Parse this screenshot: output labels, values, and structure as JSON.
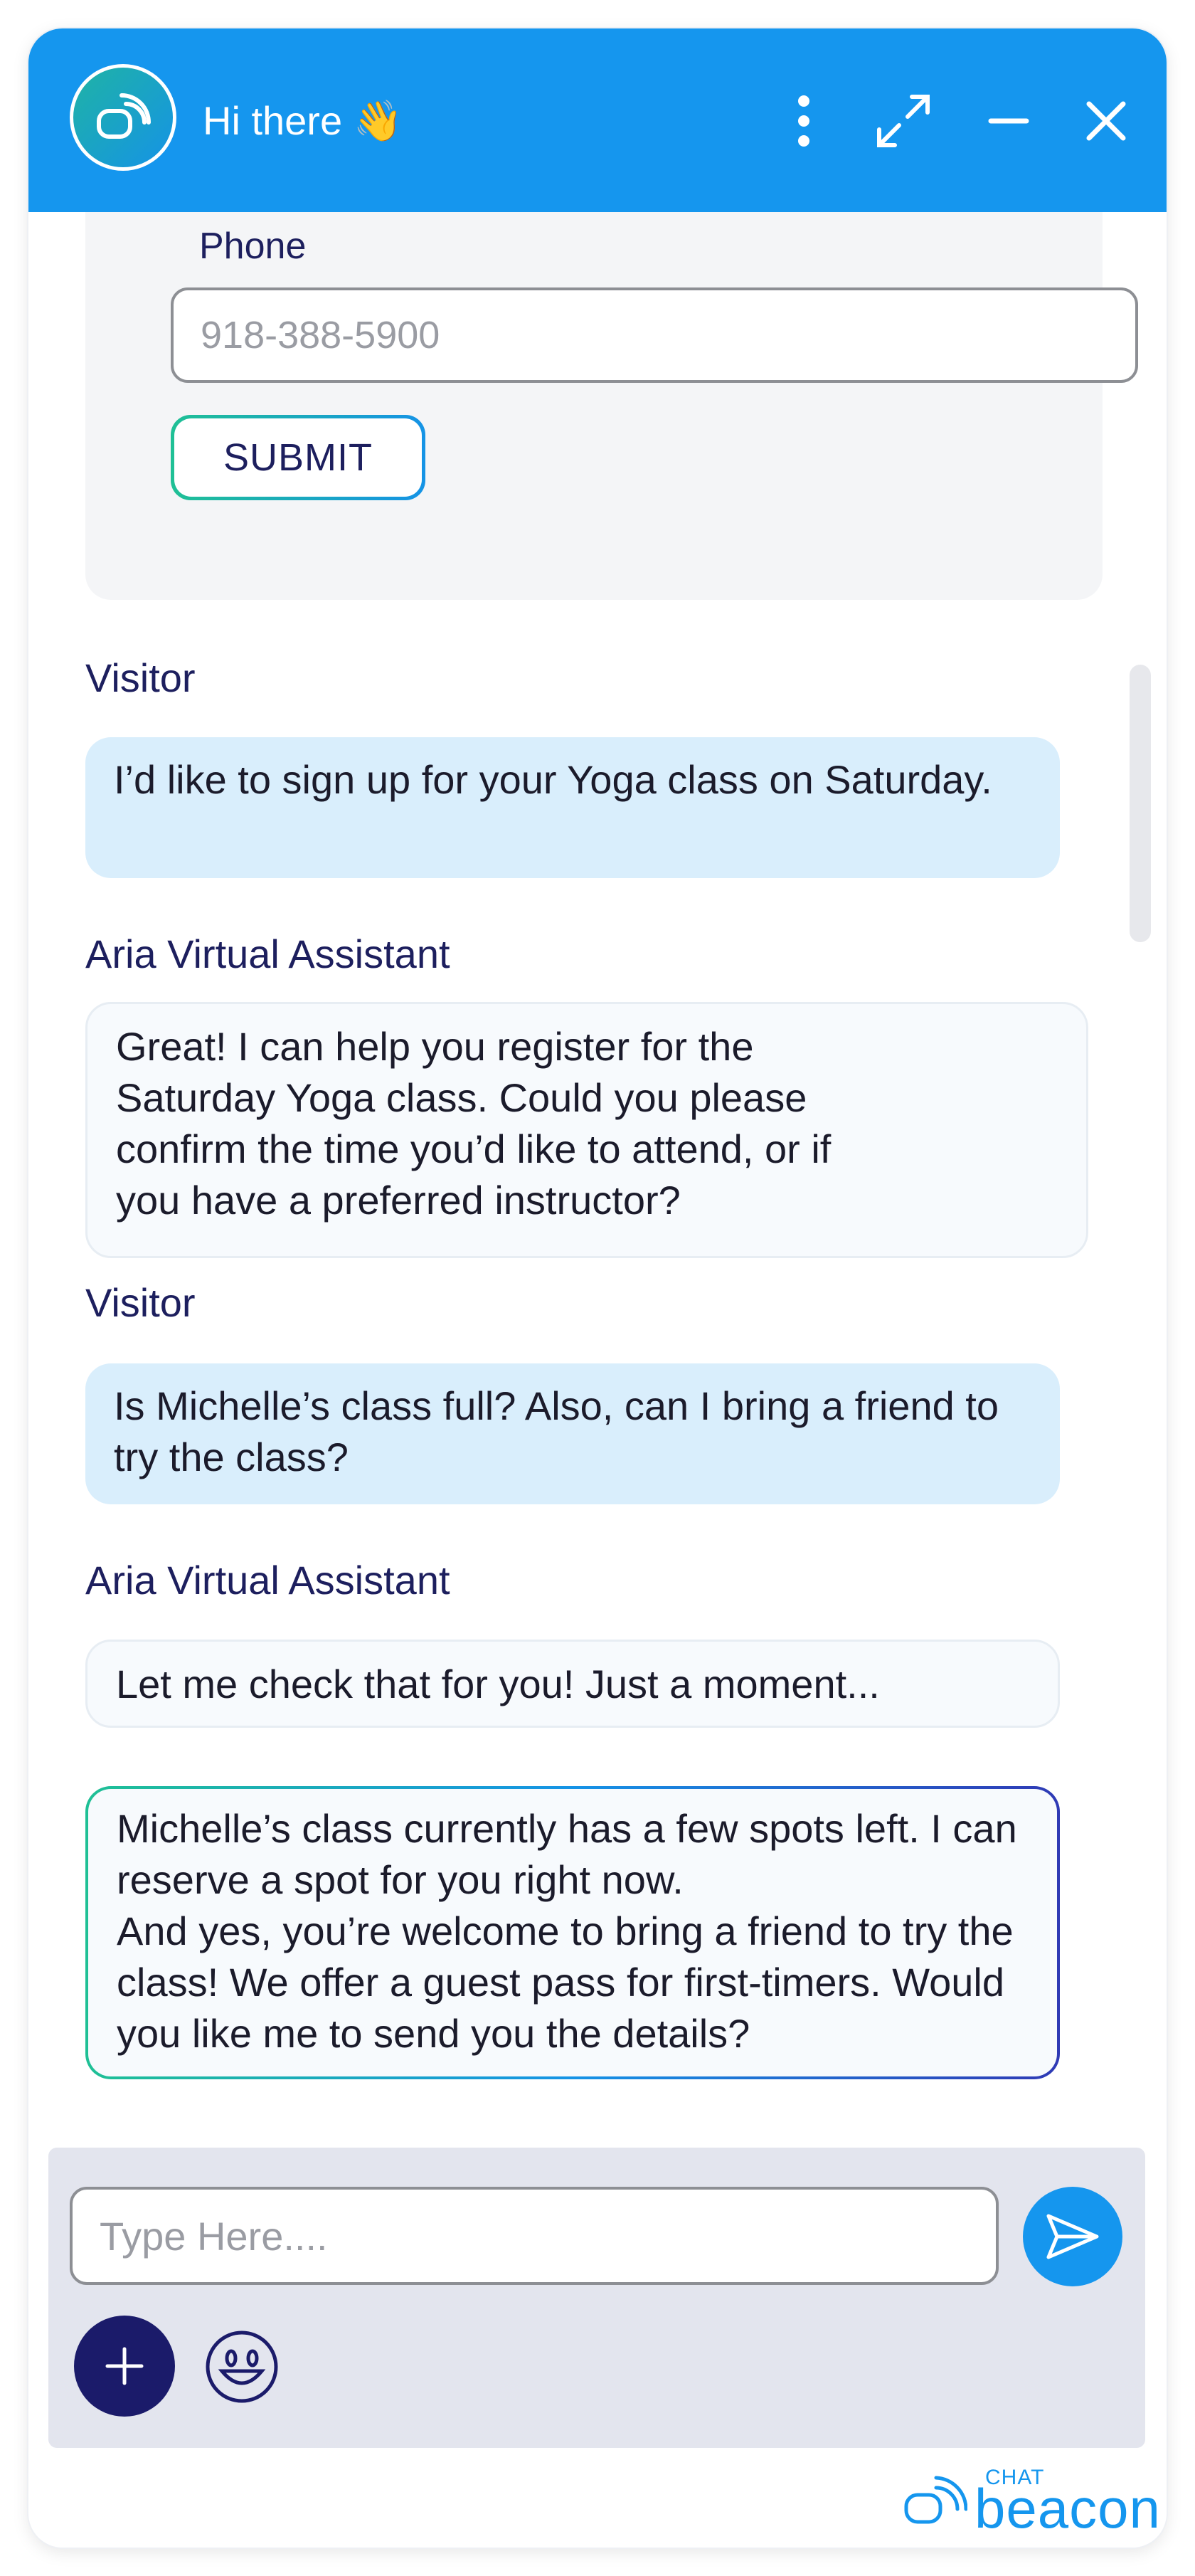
{
  "header": {
    "title": "Hi there 👋",
    "icons": [
      "chat-beacon-logo",
      "more-vertical-icon",
      "expand-icon",
      "minimize-icon",
      "close-icon"
    ],
    "background_color": "#1596ee"
  },
  "form": {
    "phone_label": "Phone",
    "phone_placeholder": "918-388-5900",
    "submit_label": "SUBMIT"
  },
  "messages": [
    {
      "sender": "Visitor",
      "text": "I’d like to sign up for your Yoga class on Saturday."
    },
    {
      "sender": "Aria Virtual Assistant",
      "text": "Great! I can help you register for the Saturday Yoga class. Could you please confirm the time you’d like to attend, or if you have a preferred instructor?"
    },
    {
      "sender": "Visitor",
      "text": "Is Michelle’s class full? Also, can I bring a friend to try the class?"
    },
    {
      "sender": "Aria Virtual Assistant",
      "text": "Let me check that for you! Just a moment..."
    },
    {
      "sender": "",
      "text_line1": "Michelle’s class currently has a few spots left. I can reserve a spot for you right now.",
      "text_line2": "And yes, you’re welcome to bring a friend to try the class! We offer a guest pass for first-timers. Would you like me to send you the details?"
    }
  ],
  "composer": {
    "placeholder": "Type Here....",
    "icons": [
      "send-icon",
      "plus-icon",
      "emoji-icon"
    ]
  },
  "brand": {
    "small": "CHAT",
    "big": "beacon"
  }
}
